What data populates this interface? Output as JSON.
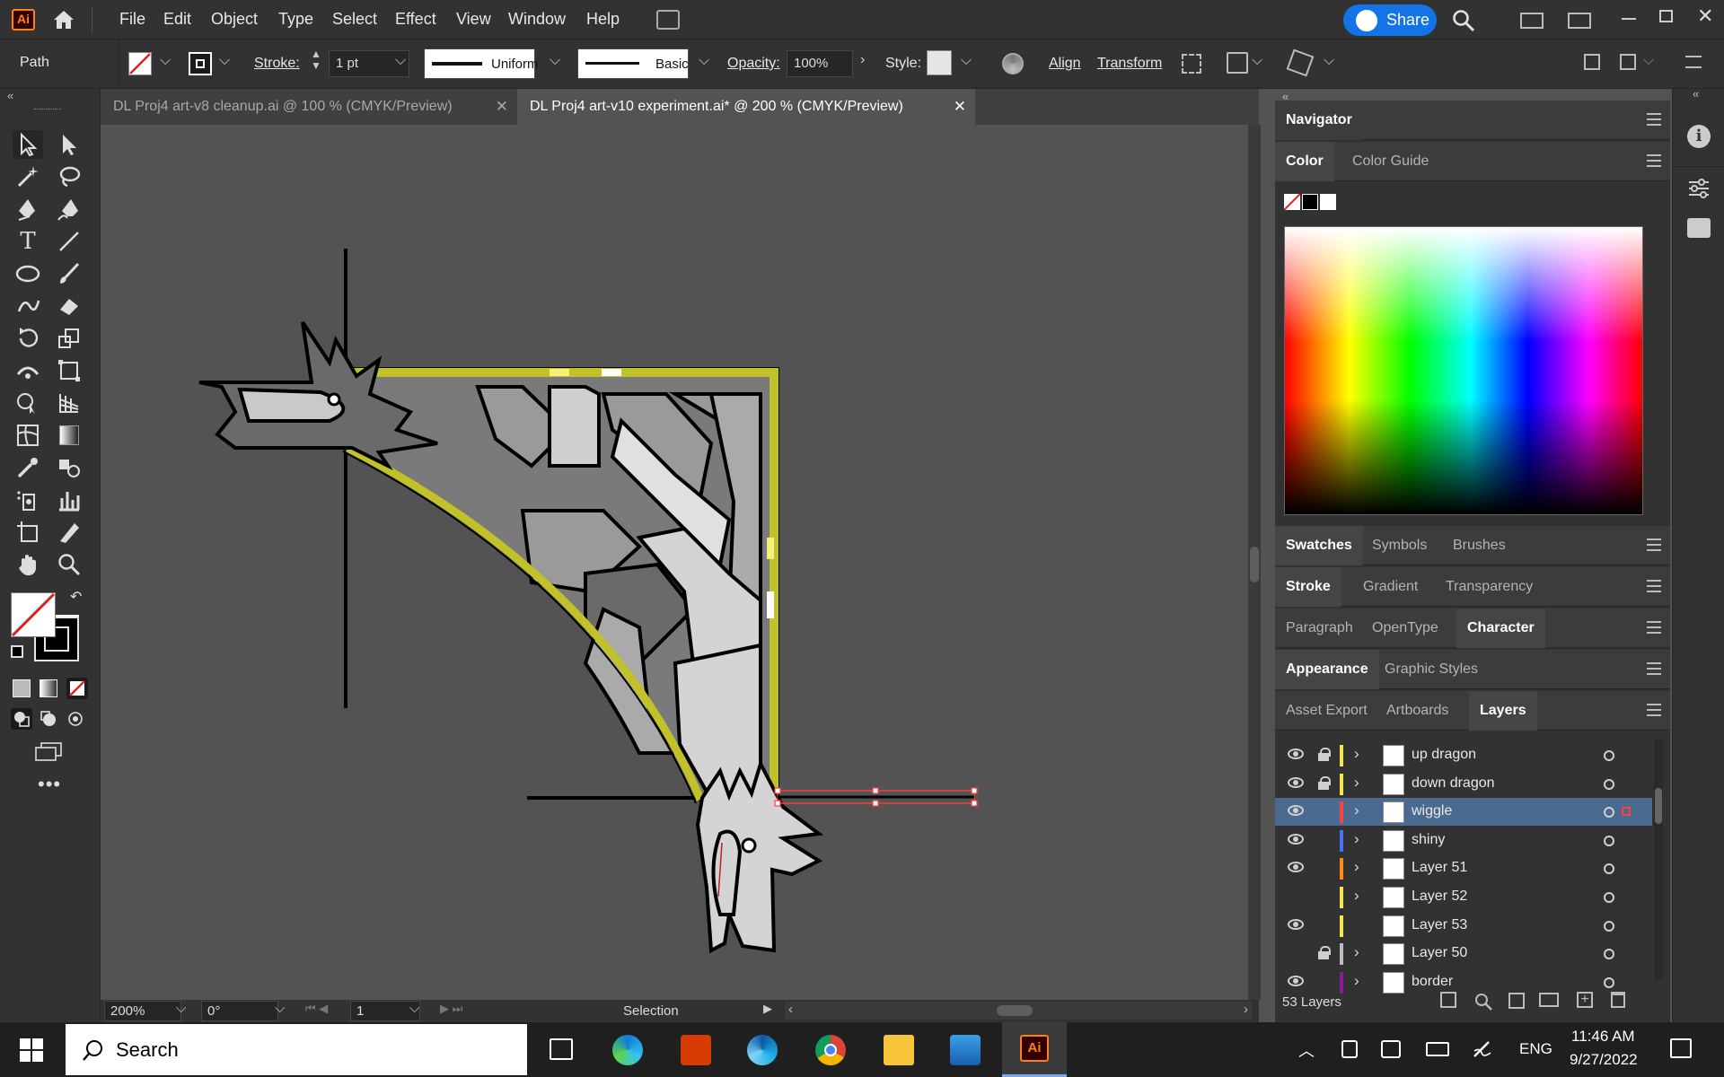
{
  "app": {
    "logo_text": "Ai",
    "menu": [
      "File",
      "Edit",
      "Object",
      "Type",
      "Select",
      "Effect",
      "View",
      "Window",
      "Help"
    ],
    "share_label": "Share"
  },
  "control_bar": {
    "selection_type": "Path",
    "stroke_label": "Stroke:",
    "stroke_value": "1 pt",
    "profile_label": "Uniform",
    "brush_label": "Basic",
    "opacity_label": "Opacity:",
    "opacity_value": "100%",
    "style_label": "Style:",
    "align_label": "Align",
    "transform_label": "Transform"
  },
  "tabs": [
    {
      "label": "DL Proj4 art-v8 cleanup.ai @ 100 % (CMYK/Preview)",
      "active": false
    },
    {
      "label": "DL Proj4 art-v10 experiment.ai* @ 200 % (CMYK/Preview)",
      "active": true
    }
  ],
  "status_bar": {
    "zoom": "200%",
    "rotation": "0°",
    "artboard": "1",
    "tool_status": "Selection"
  },
  "panels": {
    "navigator": "Navigator",
    "color_tabs": [
      "Color",
      "Color Guide"
    ],
    "swatches_tabs": [
      "Swatches",
      "Symbols",
      "Brushes"
    ],
    "stroke_tabs": [
      "Stroke",
      "Gradient",
      "Transparency"
    ],
    "type_tabs": [
      "Paragraph",
      "OpenType",
      "Character"
    ],
    "appearance_tabs": [
      "Appearance",
      "Graphic Styles"
    ],
    "layers_tabs": [
      "Asset Export",
      "Artboards",
      "Layers"
    ]
  },
  "layers": {
    "count_label": "53 Layers",
    "items": [
      {
        "name": "up dragon",
        "visible": true,
        "locked": true,
        "color": "#f5e64a",
        "expand": true,
        "selected": false
      },
      {
        "name": "down dragon",
        "visible": true,
        "locked": true,
        "color": "#f5e64a",
        "expand": true,
        "selected": false
      },
      {
        "name": "wiggle",
        "visible": true,
        "locked": false,
        "color": "#ff4040",
        "expand": true,
        "selected": true
      },
      {
        "name": "shiny",
        "visible": true,
        "locked": false,
        "color": "#4a6ef5",
        "expand": true,
        "selected": false
      },
      {
        "name": "Layer 51",
        "visible": true,
        "locked": false,
        "color": "#ff8a1a",
        "expand": true,
        "selected": false
      },
      {
        "name": "Layer 52",
        "visible": false,
        "locked": false,
        "color": "#f5e64a",
        "expand": true,
        "selected": false
      },
      {
        "name": "Layer 53",
        "visible": true,
        "locked": false,
        "color": "#f5e64a",
        "expand": false,
        "selected": false
      },
      {
        "name": "Layer 50",
        "visible": false,
        "locked": true,
        "color": "#bcbcbc",
        "expand": true,
        "selected": false
      },
      {
        "name": "border",
        "visible": true,
        "locked": false,
        "color": "#8a1a9a",
        "expand": true,
        "selected": false
      }
    ]
  },
  "taskbar": {
    "search_placeholder": "Search",
    "language": "ENG",
    "time": "11:46 AM",
    "date": "9/27/2022"
  },
  "colors": {
    "accent": "#1473e6",
    "art_yellow": "#c2c12a",
    "selection": "#ff4040"
  }
}
